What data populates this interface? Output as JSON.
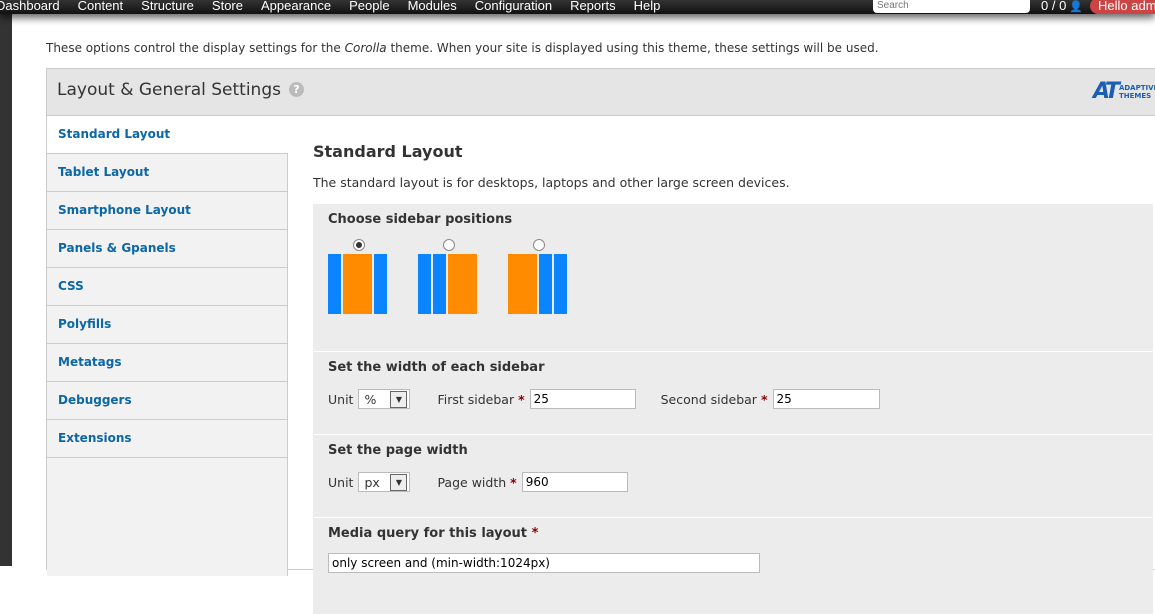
{
  "toolbar": {
    "menu": [
      "Dashboard",
      "Content",
      "Structure",
      "Store",
      "Appearance",
      "People",
      "Modules",
      "Configuration",
      "Reports",
      "Help"
    ],
    "search_placeholder": "Search",
    "user_count": "0 / 0",
    "hello": "Hello admin"
  },
  "intro": {
    "before": "These options control the display settings for the ",
    "theme": "Corolla",
    "after": " theme. When your site is displayed using this theme, these settings will be used."
  },
  "panel": {
    "title": "Layout & General Settings",
    "help": "?",
    "logo": "AT ADAPTIVE THEMES"
  },
  "tabs": [
    "Standard Layout",
    "Tablet Layout",
    "Smartphone Layout",
    "Panels & Gpanels",
    "CSS",
    "Polyfills",
    "Metatags",
    "Debuggers",
    "Extensions"
  ],
  "content": {
    "title": "Standard Layout",
    "description": "The standard layout is for desktops, laptops and other large screen devices.",
    "sidebar_positions": {
      "label": "Choose sidebar positions",
      "selected": 0
    },
    "sidebar_width": {
      "label": "Set the width of each sidebar",
      "unit_label": "Unit",
      "unit": "%",
      "first_label": "First sidebar",
      "first": "25",
      "second_label": "Second sidebar",
      "second": "25"
    },
    "page_width": {
      "label": "Set the page width",
      "unit_label": "Unit",
      "unit": "px",
      "width_label": "Page width",
      "width": "960"
    },
    "media_query": {
      "label": "Media query for this layout",
      "value": "only screen and (min-width:1024px)"
    },
    "required": "*"
  },
  "colors": {
    "sidebar": "#0a84ff",
    "main": "#ff8c00",
    "link": "#0b67a6"
  }
}
